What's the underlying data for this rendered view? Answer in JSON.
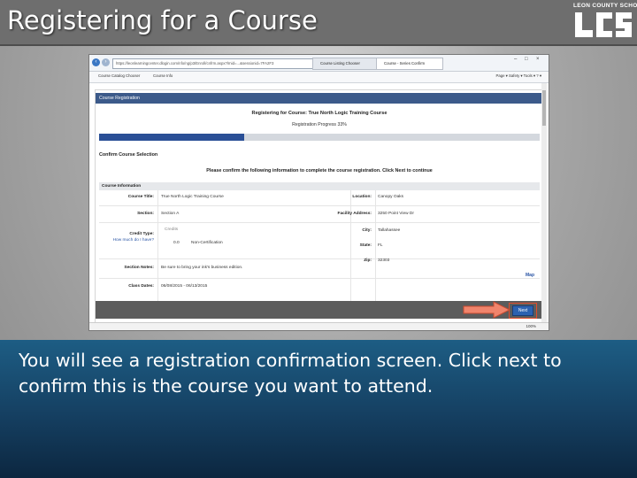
{
  "slide": {
    "title": "Registering for a Course",
    "logo_text": "LEON COUNTY SCHOOLS",
    "caption": "You will see a registration confirmation screen. Click next to confirm this is the course you want to attend."
  },
  "browser": {
    "url": "https://leonlearningcenter.dlogin.com/nfo/ng/p3/Enroll/cnfrm.aspx?lrnid=...&sessionid=7FA2F3",
    "tabs": [
      {
        "label": "Course Listing Chooser"
      },
      {
        "label": "Course - Series Confirm"
      }
    ],
    "favorites": [
      {
        "label": "Course Catalog Chooser"
      },
      {
        "label": "Course Info"
      }
    ],
    "toolbar_right": "Page ▾  Safety ▾  Tools ▾  ? ▾",
    "zoom": "100%"
  },
  "page": {
    "panel_title": "Course Registration",
    "registering_text": "Registering for Course: True North Logic Training Course",
    "progress_text": "Registration Progress 33%",
    "progress_value": 0.33,
    "confirm_heading": "Confirm Course Selection",
    "confirm_instruction": "Please confirm the following information to complete the course registration. Click Next to continue",
    "info_heading": "Course Information",
    "fields_left": [
      {
        "label": "Course Title:",
        "value": "True North Logic Training Course"
      },
      {
        "label": "Section:",
        "value": "Section A"
      },
      {
        "label": "Credit Type:",
        "value": "Credits"
      },
      {
        "label": "Section Notes:",
        "value": "Be sure to bring your ink's business edition."
      },
      {
        "label": "Class Dates:",
        "value": "06/08/2015 - 06/13/2015"
      }
    ],
    "credit_help_link": "How much do I have?",
    "credit_amount": "0.0",
    "credit_kind": "Non-Certification",
    "fields_right": [
      {
        "label": "Location:",
        "value": "Canopy Oaks"
      },
      {
        "label": "Facility Address:",
        "value": "3250 Point View Dr"
      },
      {
        "label": "City:",
        "value": "Tallahassee"
      },
      {
        "label": "State:",
        "value": "FL"
      },
      {
        "label": "Zip:",
        "value": "32303"
      }
    ],
    "map_link": "Map",
    "next_button": "Next"
  }
}
